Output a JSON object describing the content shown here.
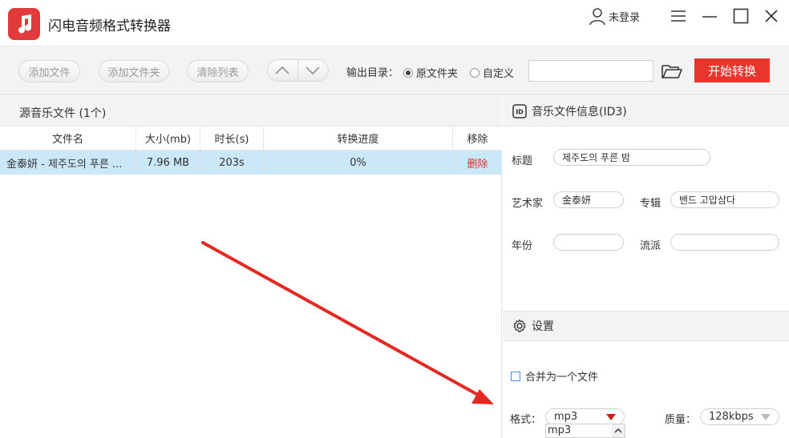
{
  "app": {
    "title": "闪电音频格式转换器",
    "user_label": "未登录"
  },
  "toolbar": {
    "add_file": "添加文件",
    "add_folder": "添加文件夹",
    "clear_list": "清除列表",
    "output_dir_label": "输出目录：",
    "radio_original": "原文件夹",
    "radio_custom": "自定义",
    "path_value": "",
    "start": "开始转换"
  },
  "file_list": {
    "header": "源音乐文件 (1个)",
    "columns": [
      "文件名",
      "大小(mb)",
      "时长(s)",
      "转换进度",
      "移除"
    ],
    "rows": [
      {
        "name": "金泰妍 - 제주도의 푸른 ...",
        "size": "7.96 MB",
        "duration": "203s",
        "progress": "0%",
        "remove": "删除"
      }
    ]
  },
  "id3": {
    "header": "音乐文件信息(ID3)",
    "title_label": "标题",
    "title_value": "제주도의 푸른 밤",
    "artist_label": "艺术家",
    "artist_value": "金泰妍",
    "album_label": "专辑",
    "album_value": "밴드 고맙삼다",
    "year_label": "年份",
    "year_value": "",
    "genre_label": "流派",
    "genre_value": ""
  },
  "settings": {
    "header": "设置",
    "merge_label": "合并为一个文件",
    "format_label": "格式：",
    "format_value": "mp3",
    "quality_label": "质量：",
    "quality_value": "128kbps",
    "dropdown_first": "mp3"
  },
  "colors": {
    "accent_red": "#e8352e",
    "selected_row": "#cbe8f8",
    "delete_red": "#e0302a"
  }
}
